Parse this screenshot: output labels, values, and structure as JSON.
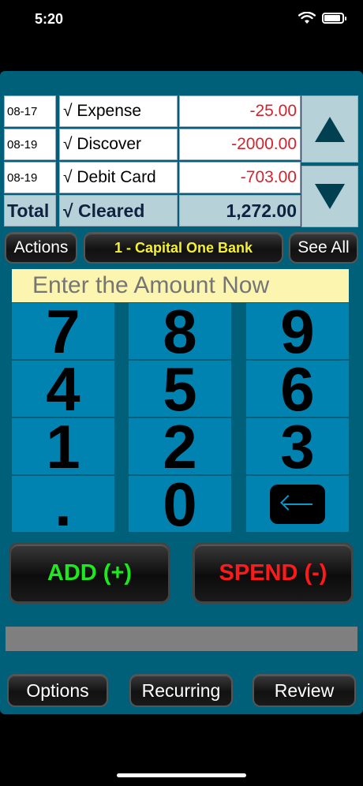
{
  "status_bar": {
    "time": "5:20"
  },
  "register": {
    "rows": [
      {
        "date": "08-17",
        "description": "√ Expense",
        "amount": "-25.00"
      },
      {
        "date": "08-19",
        "description": "√ Discover",
        "amount": "-2000.00"
      },
      {
        "date": "08-19",
        "description": "√ Debit Card",
        "amount": "-703.00"
      }
    ],
    "total": {
      "label": "Total",
      "description": "√ Cleared",
      "amount": "1,272.00"
    }
  },
  "toolbar": {
    "actions_label": "Actions",
    "account_label": "1 - Capital One Bank",
    "see_all_label": "See All"
  },
  "amount_field": {
    "placeholder": "Enter the Amount Now"
  },
  "keypad": {
    "keys": [
      "7",
      "8",
      "9",
      "4",
      "5",
      "6",
      "1",
      "2",
      "3",
      ".",
      "0"
    ],
    "backspace_icon": "left-arrow-icon"
  },
  "actions": {
    "add_label": "ADD (+)",
    "spend_label": "SPEND (-)"
  },
  "bottom_bar": {
    "options_label": "Options",
    "recurring_label": "Recurring",
    "review_label": "Review"
  },
  "colors": {
    "panel": "#00607a",
    "key": "#0083b0",
    "add": "#1ee81e",
    "spend": "#ff1a1a",
    "account_text": "#f5f032",
    "negative_amount": "#d4232c",
    "amount_field_bg": "#fbf5b0"
  }
}
